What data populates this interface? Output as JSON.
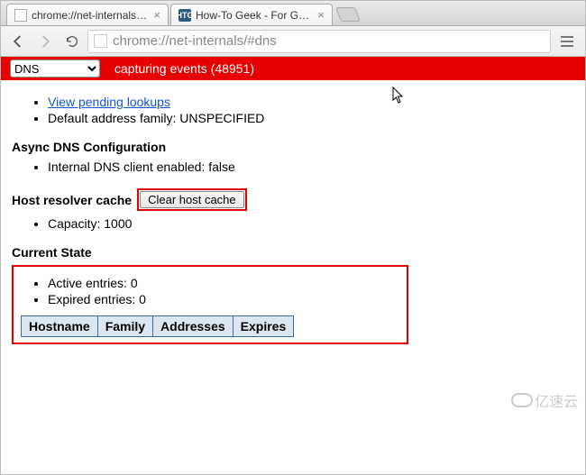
{
  "browser": {
    "tabs": [
      {
        "title": "chrome://net-internals/#d",
        "favicon": "default"
      },
      {
        "title": "How-To Geek - For Geeks,",
        "favicon": "HTG"
      }
    ],
    "url": "chrome://net-internals/#dns"
  },
  "capture_bar": {
    "dropdown_value": "DNS",
    "status_prefix": "capturing events",
    "event_count": "(48951)"
  },
  "top_list": {
    "pending_lookups_link": "View pending lookups",
    "default_family_label": "Default address family: ",
    "default_family_value": "UNSPECIFIED"
  },
  "async_dns": {
    "heading": "Async DNS Configuration",
    "internal_client_label": "Internal DNS client enabled: ",
    "internal_client_value": "false"
  },
  "host_cache": {
    "heading": "Host resolver cache",
    "clear_button": "Clear host cache",
    "capacity_label": "Capacity: ",
    "capacity_value": "1000"
  },
  "current_state": {
    "heading": "Current State",
    "active_label": "Active entries: ",
    "active_value": "0",
    "expired_label": "Expired entries: ",
    "expired_value": "0",
    "table_headers": [
      "Hostname",
      "Family",
      "Addresses",
      "Expires"
    ]
  },
  "watermark": "亿速云"
}
